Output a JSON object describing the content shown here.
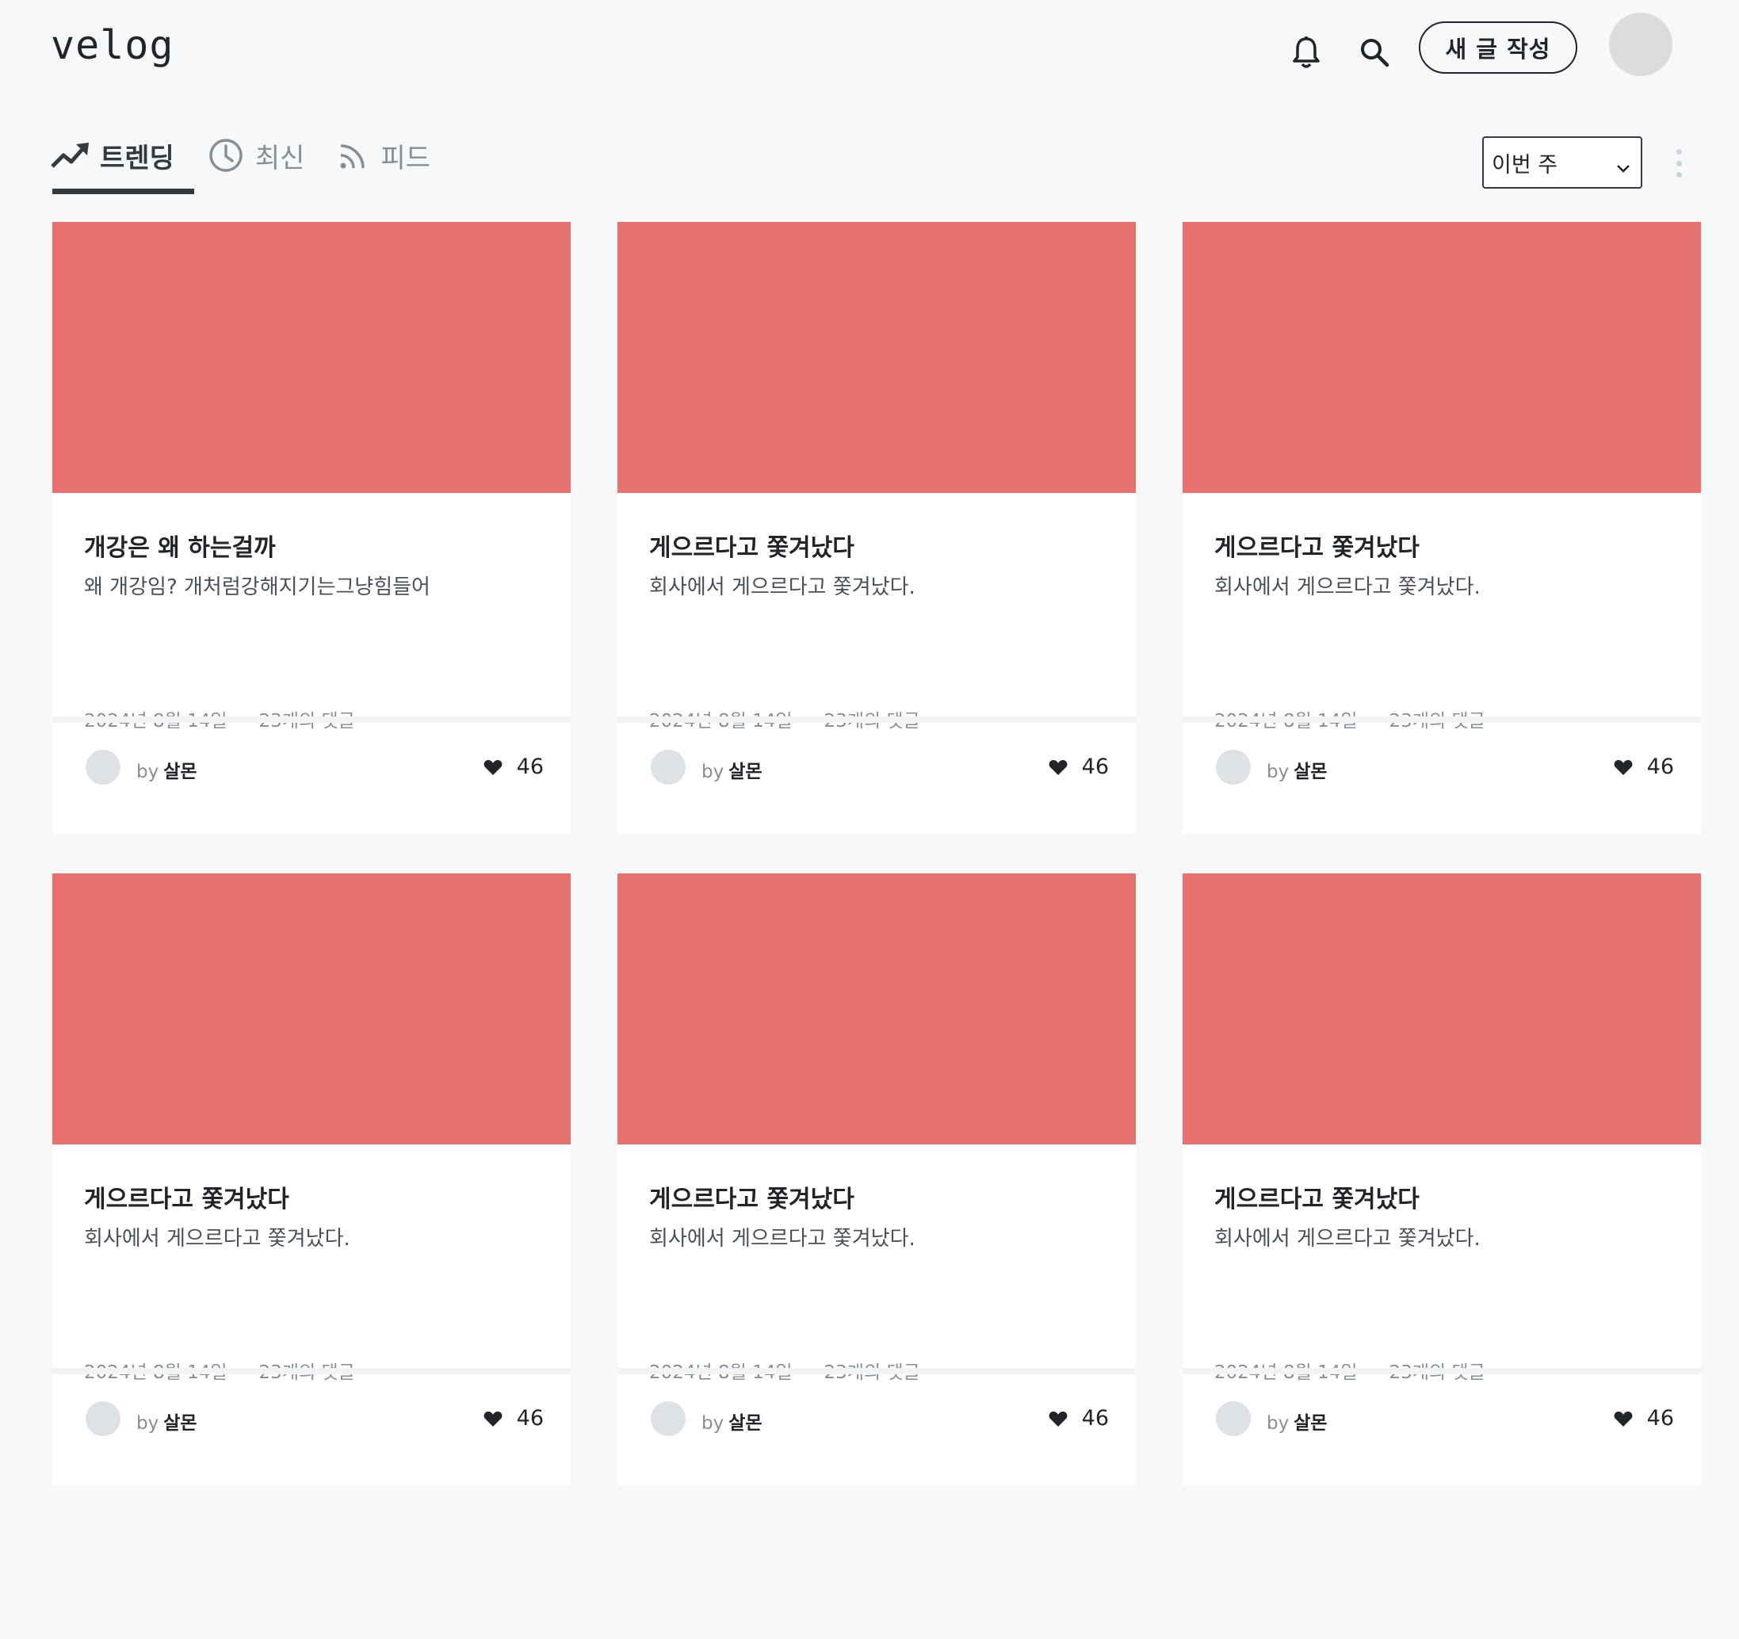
{
  "header": {
    "logo": "velog",
    "write_label": "새 글 작성",
    "icons": [
      "bell-icon",
      "search-icon"
    ]
  },
  "tabs": [
    {
      "label": "트렌딩",
      "icon": "trending-icon",
      "active": true
    },
    {
      "label": "최신",
      "icon": "clock-icon",
      "active": false
    },
    {
      "label": "피드",
      "icon": "rss-icon",
      "active": false
    }
  ],
  "filter": {
    "selected": "이번 주"
  },
  "colors": {
    "thumbnail": "#e8736e",
    "background": "#f7f8fa",
    "text": "#212529"
  },
  "posts": [
    {
      "title": "개강은 왜 하는걸까",
      "description": "왜 개강임? 개처럼강해지기는그냥힘들어",
      "date": "2024년 8월 14일",
      "comments": "23개의 댓글",
      "by": "by",
      "author": "살몬",
      "likes": "46"
    },
    {
      "title": "게으르다고 쫓겨났다",
      "description": "회사에서 게으르다고 쫓겨났다.",
      "date": "2024년 8월 14일",
      "comments": "23개의 댓글",
      "by": "by",
      "author": "살몬",
      "likes": "46"
    },
    {
      "title": "게으르다고 쫓겨났다",
      "description": "회사에서 게으르다고 쫓겨났다.",
      "date": "2024년 8월 14일",
      "comments": "23개의 댓글",
      "by": "by",
      "author": "살몬",
      "likes": "46"
    },
    {
      "title": "게으르다고 쫓겨났다",
      "description": "회사에서 게으르다고 쫓겨났다.",
      "date": "2024년 8월 14일",
      "comments": "23개의 댓글",
      "by": "by",
      "author": "살몬",
      "likes": "46"
    },
    {
      "title": "게으르다고 쫓겨났다",
      "description": "회사에서 게으르다고 쫓겨났다.",
      "date": "2024년 8월 14일",
      "comments": "23개의 댓글",
      "by": "by",
      "author": "살몬",
      "likes": "46"
    },
    {
      "title": "게으르다고 쫓겨났다",
      "description": "회사에서 게으르다고 쫓겨났다.",
      "date": "2024년 8월 14일",
      "comments": "23개의 댓글",
      "by": "by",
      "author": "살몬",
      "likes": "46"
    }
  ]
}
